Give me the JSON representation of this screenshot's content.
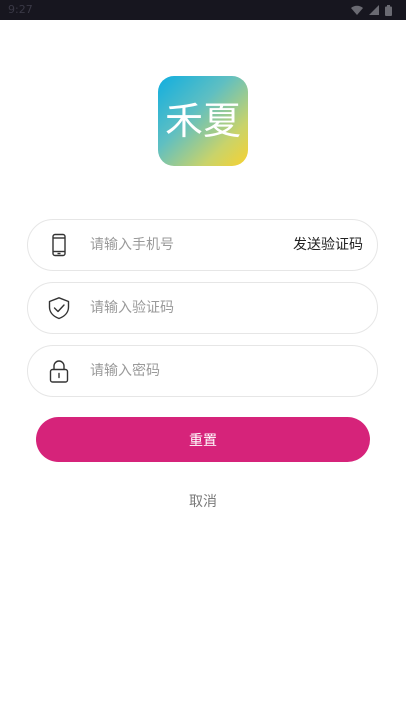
{
  "status_bar": {
    "time": "9:27",
    "icons": [
      "wifi-icon",
      "signal-icon",
      "battery-icon"
    ]
  },
  "logo": {
    "text": "禾夏",
    "colors": [
      "#10aee0",
      "#f7d230"
    ]
  },
  "form": {
    "phone": {
      "placeholder": "请输入手机号",
      "value": "",
      "icon": "phone-icon",
      "action_label": "发送验证码"
    },
    "code": {
      "placeholder": "请输入验证码",
      "value": "",
      "icon": "shield-check-icon"
    },
    "password": {
      "placeholder": "请输入密码",
      "value": "",
      "icon": "lock-icon"
    }
  },
  "buttons": {
    "reset_label": "重置",
    "cancel_label": "取消"
  },
  "colors": {
    "accent": "#d6237a",
    "status_bar": "#17161f"
  }
}
